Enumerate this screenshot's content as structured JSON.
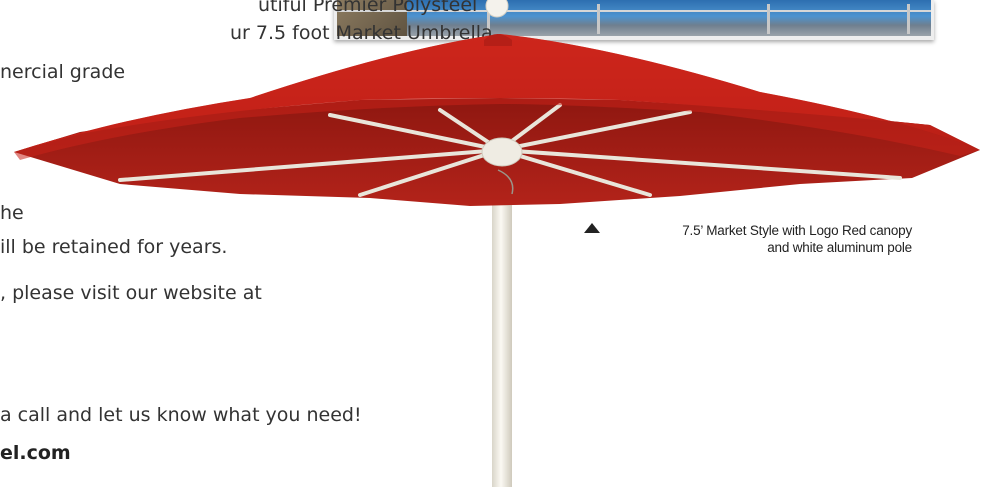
{
  "text_lines": [
    "utiful Premier Polysteel",
    "ur 7.5 foot Market Umbrella",
    "nercial grade",
    "he",
    "ill be retained for years.",
    ", please visit our website at",
    "a call and let us know what you need!",
    "el.com"
  ],
  "caption": {
    "line1": "7.5’ Market Style with Logo Red canopy",
    "line2": "and white aluminum pole"
  },
  "colors": {
    "canopy": "#c8231a",
    "canopy_dark": "#9e1a13",
    "pole": "#f2efe6"
  },
  "icons": {
    "caption_pointer": "triangle-up-icon"
  }
}
